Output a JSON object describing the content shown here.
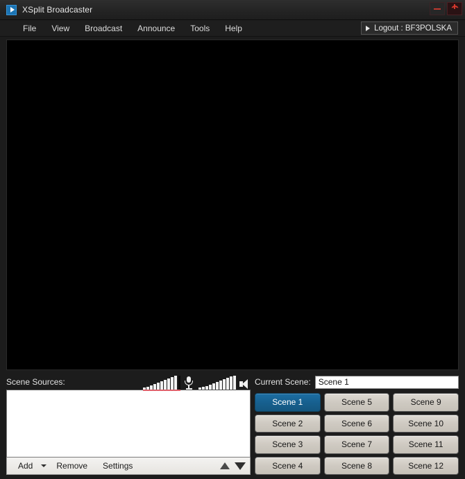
{
  "window": {
    "title": "XSplit Broadcaster",
    "app_icon": "play-icon",
    "controls": {
      "minimize": "minimize-icon",
      "power": "power-icon"
    }
  },
  "menubar": {
    "items": [
      {
        "label": "File"
      },
      {
        "label": "View"
      },
      {
        "label": "Broadcast"
      },
      {
        "label": "Announce"
      },
      {
        "label": "Tools"
      },
      {
        "label": "Help"
      }
    ],
    "logout": {
      "label": "Logout : BF3POLSKA",
      "icon": "triangle-right-icon"
    }
  },
  "preview": {
    "background_color": "#000000"
  },
  "sources": {
    "label": "Scene Sources:",
    "list_items": [],
    "toolbar": {
      "add_label": "Add",
      "add_caret": "caret-down-icon",
      "remove_label": "Remove",
      "settings_label": "Settings",
      "move_up_icon": "arrow-up-icon",
      "move_down_icon": "arrow-down-icon"
    },
    "meters": {
      "mic": {
        "icon": "microphone-icon",
        "levels": [
          3,
          4,
          6,
          8,
          10,
          12,
          14,
          16,
          18,
          20
        ],
        "peak_indicator": true,
        "clip_color": "#e0606a"
      },
      "speaker": {
        "icon": "speaker-icon",
        "levels": [
          3,
          4,
          5,
          7,
          9,
          11,
          13,
          15,
          17,
          19,
          20
        ],
        "peak_indicator": false
      }
    }
  },
  "scenes": {
    "current_scene_label": "Current Scene:",
    "current_scene_name": "Scene 1",
    "active_index": 0,
    "accent_color": "#1a6496",
    "buttons": [
      {
        "label": "Scene 1"
      },
      {
        "label": "Scene 2"
      },
      {
        "label": "Scene 3"
      },
      {
        "label": "Scene 4"
      },
      {
        "label": "Scene 5"
      },
      {
        "label": "Scene 6"
      },
      {
        "label": "Scene 7"
      },
      {
        "label": "Scene 8"
      },
      {
        "label": "Scene 9"
      },
      {
        "label": "Scene 10"
      },
      {
        "label": "Scene 11"
      },
      {
        "label": "Scene 12"
      }
    ]
  }
}
